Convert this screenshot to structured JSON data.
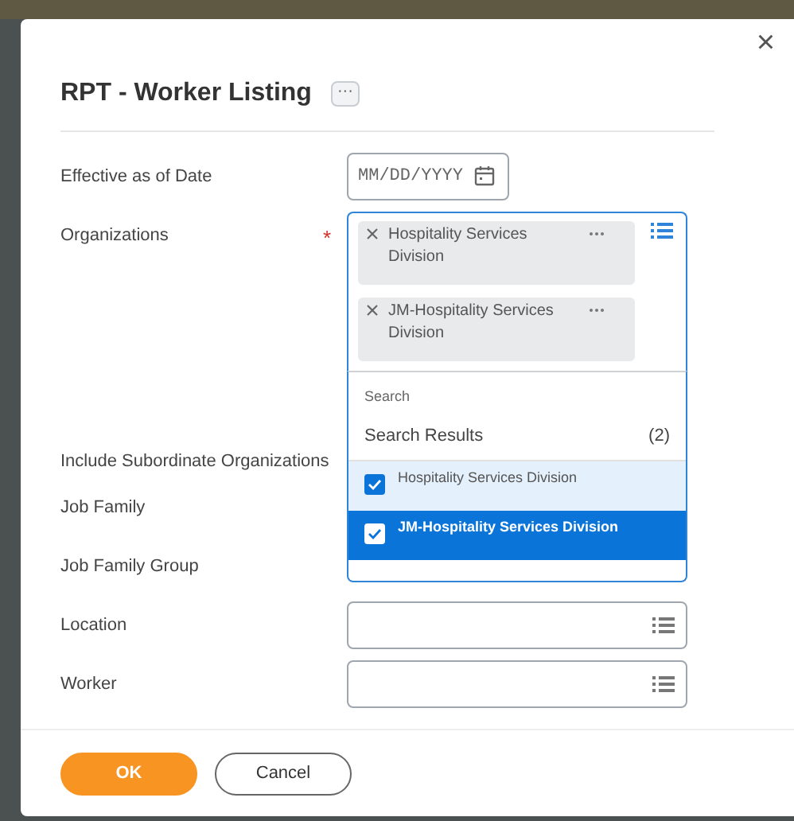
{
  "dialog": {
    "title": "RPT - Worker Listing",
    "more": "···",
    "close": "×"
  },
  "fields": [
    {
      "kind": "date",
      "label": "Effective as of Date",
      "placeholder": "MM/DD/YYYY"
    },
    {
      "kind": "multiselect",
      "label": "Organizations",
      "required_mark": "*",
      "chips": [
        {
          "label": "Hospitality Services Division"
        },
        {
          "label": "JM-Hospitality Services Division"
        }
      ],
      "popup": {
        "search_placeholder": "Search",
        "results_title": "Search Results",
        "results_count": "(2)",
        "results": [
          {
            "label": "Hospitality Services Division",
            "checked": true,
            "selected": false,
            "hovered": true
          },
          {
            "label": "JM-Hospitality Services Division",
            "checked": true,
            "selected": true,
            "hovered": false
          }
        ]
      }
    },
    {
      "kind": "hidden",
      "label": "Include Subordinate Organizations"
    },
    {
      "kind": "hidden",
      "label": "Job Family"
    },
    {
      "kind": "hidden",
      "label": "Job Family Group"
    },
    {
      "kind": "prompt",
      "label": "Location"
    },
    {
      "kind": "prompt",
      "label": "Worker"
    }
  ],
  "buttons": [
    {
      "label": "OK",
      "kind": "primary"
    },
    {
      "label": "Cancel",
      "kind": "secondary"
    }
  ]
}
